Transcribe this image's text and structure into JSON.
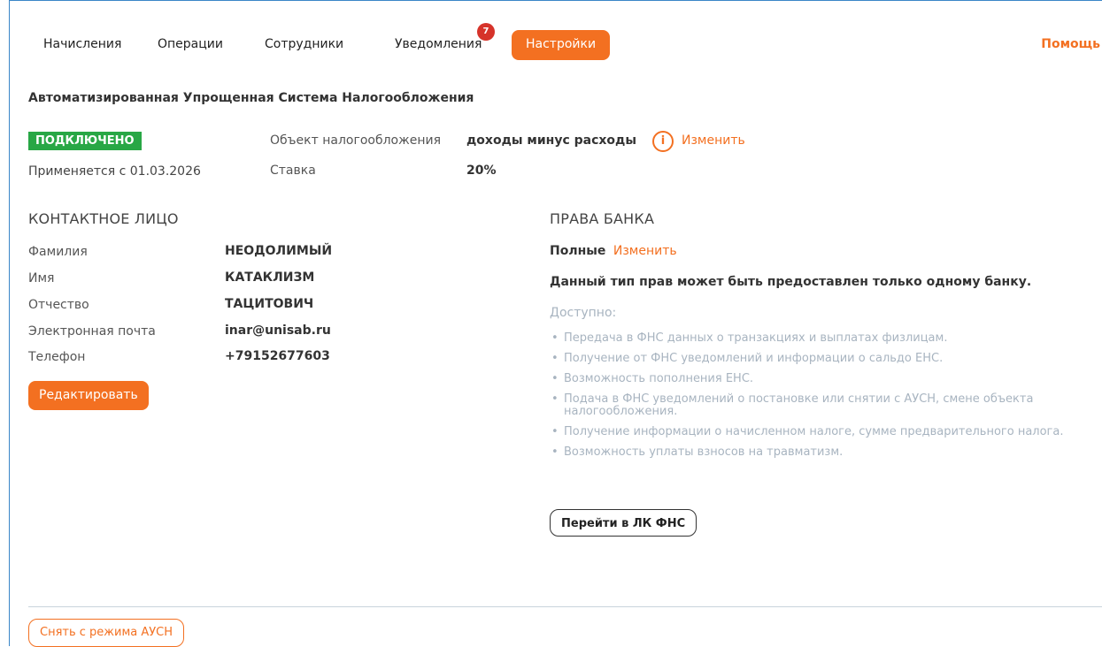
{
  "nav": {
    "items": [
      "Начисления",
      "Операции",
      "Сотрудники",
      "Уведомления"
    ],
    "notifications_badge": "7",
    "active": "Настройки",
    "help": "Помощь"
  },
  "title": "Автоматизированная Упрощенная Система Налогообложения",
  "status": {
    "badge": "ПОДКЛЮЧЕНО",
    "applied": "Применяется с 01.03.2026",
    "color": "#28a745"
  },
  "tax": {
    "object_label": "Объект налогообложения",
    "object_value": "доходы минус расходы",
    "info_icon": "i",
    "change_link": "Изменить",
    "rate_label": "Ставка",
    "rate_value": "20%"
  },
  "contact": {
    "heading": "КОНТАКТНОЕ ЛИЦО",
    "fields": [
      {
        "label": "Фамилия",
        "value": "НЕОДОЛИМЫЙ"
      },
      {
        "label": "Имя",
        "value": "КАТАКЛИЗМ"
      },
      {
        "label": "Отчество",
        "value": "ТАЦИТОВИЧ"
      },
      {
        "label": "Электронная почта",
        "value": "inar@unisab.ru"
      },
      {
        "label": "Телефон",
        "value": "+79152677603"
      }
    ],
    "edit_button": "Редактировать"
  },
  "rights": {
    "heading": "ПРАВА БАНКА",
    "level": "Полные",
    "change_link": "Изменить",
    "note": "Данный тип прав может быть предоставлен только одному банку.",
    "available_label": "Доступно:",
    "items": [
      "Передача в ФНС данных о транзакциях и выплатах физлицам.",
      "Получение от ФНС уведомлений и информации о сальдо ЕНС.",
      "Возможность пополнения ЕНС.",
      "Подача в ФНС уведомлений о постановке или снятии с АУСН, смене объекта налогообложения.",
      "Получение информации о начисленном налоге, сумме предварительного налога.",
      "Возможность уплаты взносов на травматизм."
    ],
    "fns_button": "Перейти в ЛК ФНС"
  },
  "footer": {
    "remove_button": "Снять с режима АУСН"
  },
  "colors": {
    "accent": "#f37021",
    "badge": "#d6332a",
    "frame": "#3a86c8"
  }
}
